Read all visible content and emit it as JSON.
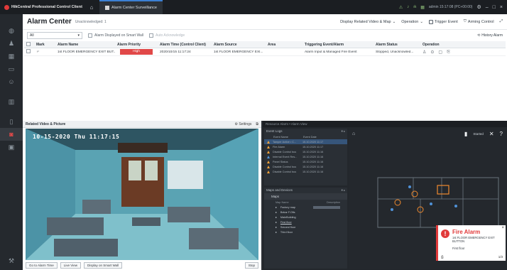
{
  "titlebar": {
    "app_name": "HikCentral Professional Control Client",
    "tab_label": "Alarm Center Surveillance",
    "user": "admin 15:17:08 (PC+00:00)",
    "icons": [
      "home-icon",
      "user-icon",
      "minimize-icon",
      "maximize-icon",
      "close-icon"
    ]
  },
  "sidebar": {
    "items": [
      {
        "name": "globe-icon",
        "glyph": "◍"
      },
      {
        "name": "people-icon",
        "glyph": "♟"
      },
      {
        "name": "grid-icon",
        "glyph": "▦"
      },
      {
        "name": "monitor-icon",
        "glyph": "▭"
      },
      {
        "name": "person-icon",
        "glyph": "☺"
      },
      {
        "name": "layout-icon",
        "glyph": "▥"
      },
      {
        "name": "door-icon",
        "glyph": "▯"
      },
      {
        "name": "alarm-icon",
        "glyph": "◙",
        "active": true
      },
      {
        "name": "map-icon",
        "glyph": "▣"
      }
    ]
  },
  "header": {
    "title": "Alarm Center",
    "subtitle": "Unacknowledged: 1",
    "display_related": "Display Related Video & Map",
    "operation": "Operation",
    "trigger_event": "Trigger Event",
    "arming_control": "Arming Control"
  },
  "filters": {
    "select_value": "All",
    "smart_wall": "Alarm Displayed on Smart Wall",
    "auto_ack": "Auto Acknowledge",
    "history": "History Alarm"
  },
  "table": {
    "columns": [
      "Mark",
      "Alarm Name",
      "Alarm Priority",
      "Alarm Time (Control Client)",
      "Alarm Source",
      "Area",
      "Triggering Event/Alarm",
      "Alarm Status",
      "Operation"
    ],
    "rows": [
      {
        "mark": "⚐",
        "name": "1st FLOOR EMERGENCY EXIT BUT...",
        "priority": "High",
        "time": "2020/10/15 11:17:24",
        "source": "1st FLOOR EMERGENCY EXI...",
        "area": "",
        "trigger": "Alarm Input & Managed Fire Event",
        "status": "Stopped, Unacknowled..."
      }
    ]
  },
  "video_panel": {
    "title": "Related Video & Picture",
    "settings": "Settings",
    "osd_text": "10-15-2020 Thu 11:17:15",
    "buttons": {
      "alarm_time": "Go to Alarm Time",
      "live_view": "Live View",
      "smart_wall": "Display on Smart Wall",
      "stop": "Stop"
    }
  },
  "dark_panel": {
    "title": "Resource Alarm • Alarm View",
    "event_logs": {
      "title": "Event Logs",
      "col_name": "Event Name",
      "col_date": "Event Date",
      "rows": [
        {
          "name": "Tamper Active • C...",
          "date": "15.10.2020 11:17",
          "color": "orange",
          "selected": true
        },
        {
          "name": "Fire Alarm",
          "date": "15.10.2020 11:17",
          "color": "orange"
        },
        {
          "name": "Disable Control bus",
          "date": "15.10.2020 11:16",
          "color": "orange"
        },
        {
          "name": "Internal Event Res...",
          "date": "15.10.2020 11:16",
          "color": "blue"
        },
        {
          "name": "Panel Status",
          "date": "15.10.2020 11:16",
          "color": "orange"
        },
        {
          "name": "Disable Control bus",
          "date": "15.10.2020 11:16",
          "color": "orange"
        },
        {
          "name": "Disable Control bus",
          "date": "15.10.2020 11:16",
          "color": "orange"
        }
      ]
    },
    "maps": {
      "title": "Maps and Devices",
      "tab": "Maps",
      "col_name": "Map Name",
      "col_description": "Description",
      "rows": [
        "Factory map",
        "Bekar F.Ofis",
        "MainBuilding",
        "First floor",
        "Second floor",
        "Third floor"
      ]
    },
    "map_view": {
      "started_label": "Started"
    },
    "alarm_popup": {
      "title": "Fire Alarm",
      "description": "1st FLOOR EMERGENCY EXIT BUTTON",
      "floor": "First floor",
      "counter": "1/3"
    }
  }
}
